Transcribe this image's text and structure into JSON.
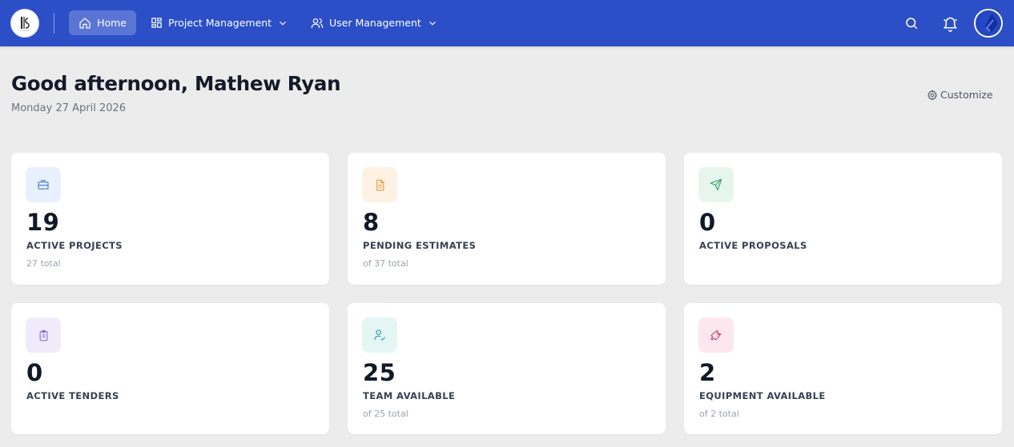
{
  "nav": {
    "home": {
      "label": "Home",
      "icon": "home-icon"
    },
    "project_management": {
      "label": "Project Management",
      "icon": "grid-icon"
    },
    "user_management": {
      "label": "User Management",
      "icon": "users-icon"
    }
  },
  "header": {
    "greeting": "Good afternoon, Mathew Ryan",
    "date": "Monday 27 April 2026",
    "customize_label": "Customize"
  },
  "cards": [
    {
      "value": "19",
      "label": "ACTIVE PROJECTS",
      "sub": "27 total",
      "icon": "briefcase-icon",
      "color": "#4a7fd4",
      "bg": "#e8f0fd"
    },
    {
      "value": "8",
      "label": "PENDING ESTIMATES",
      "sub": "of 37 total",
      "icon": "document-icon",
      "color": "#e69a3c",
      "bg": "#fdf1e3"
    },
    {
      "value": "0",
      "label": "ACTIVE PROPOSALS",
      "sub": "",
      "icon": "send-icon",
      "color": "#3aa56e",
      "bg": "#e6f6ee"
    },
    {
      "value": "0",
      "label": "ACTIVE TENDERS",
      "sub": "",
      "icon": "clipboard-icon",
      "color": "#8b6fd6",
      "bg": "#efebfb"
    },
    {
      "value": "25",
      "label": "TEAM AVAILABLE",
      "sub": "of 25 total",
      "icon": "user-check-icon",
      "color": "#3aa0a8",
      "bg": "#e4f5f6"
    },
    {
      "value": "2",
      "label": "EQUIPMENT AVAILABLE",
      "sub": "of 2 total",
      "icon": "wrench-icon",
      "color": "#d6457a",
      "bg": "#fce7ef"
    }
  ],
  "colors": {
    "topbar": "#2c4fc7",
    "background": "#ececec"
  }
}
